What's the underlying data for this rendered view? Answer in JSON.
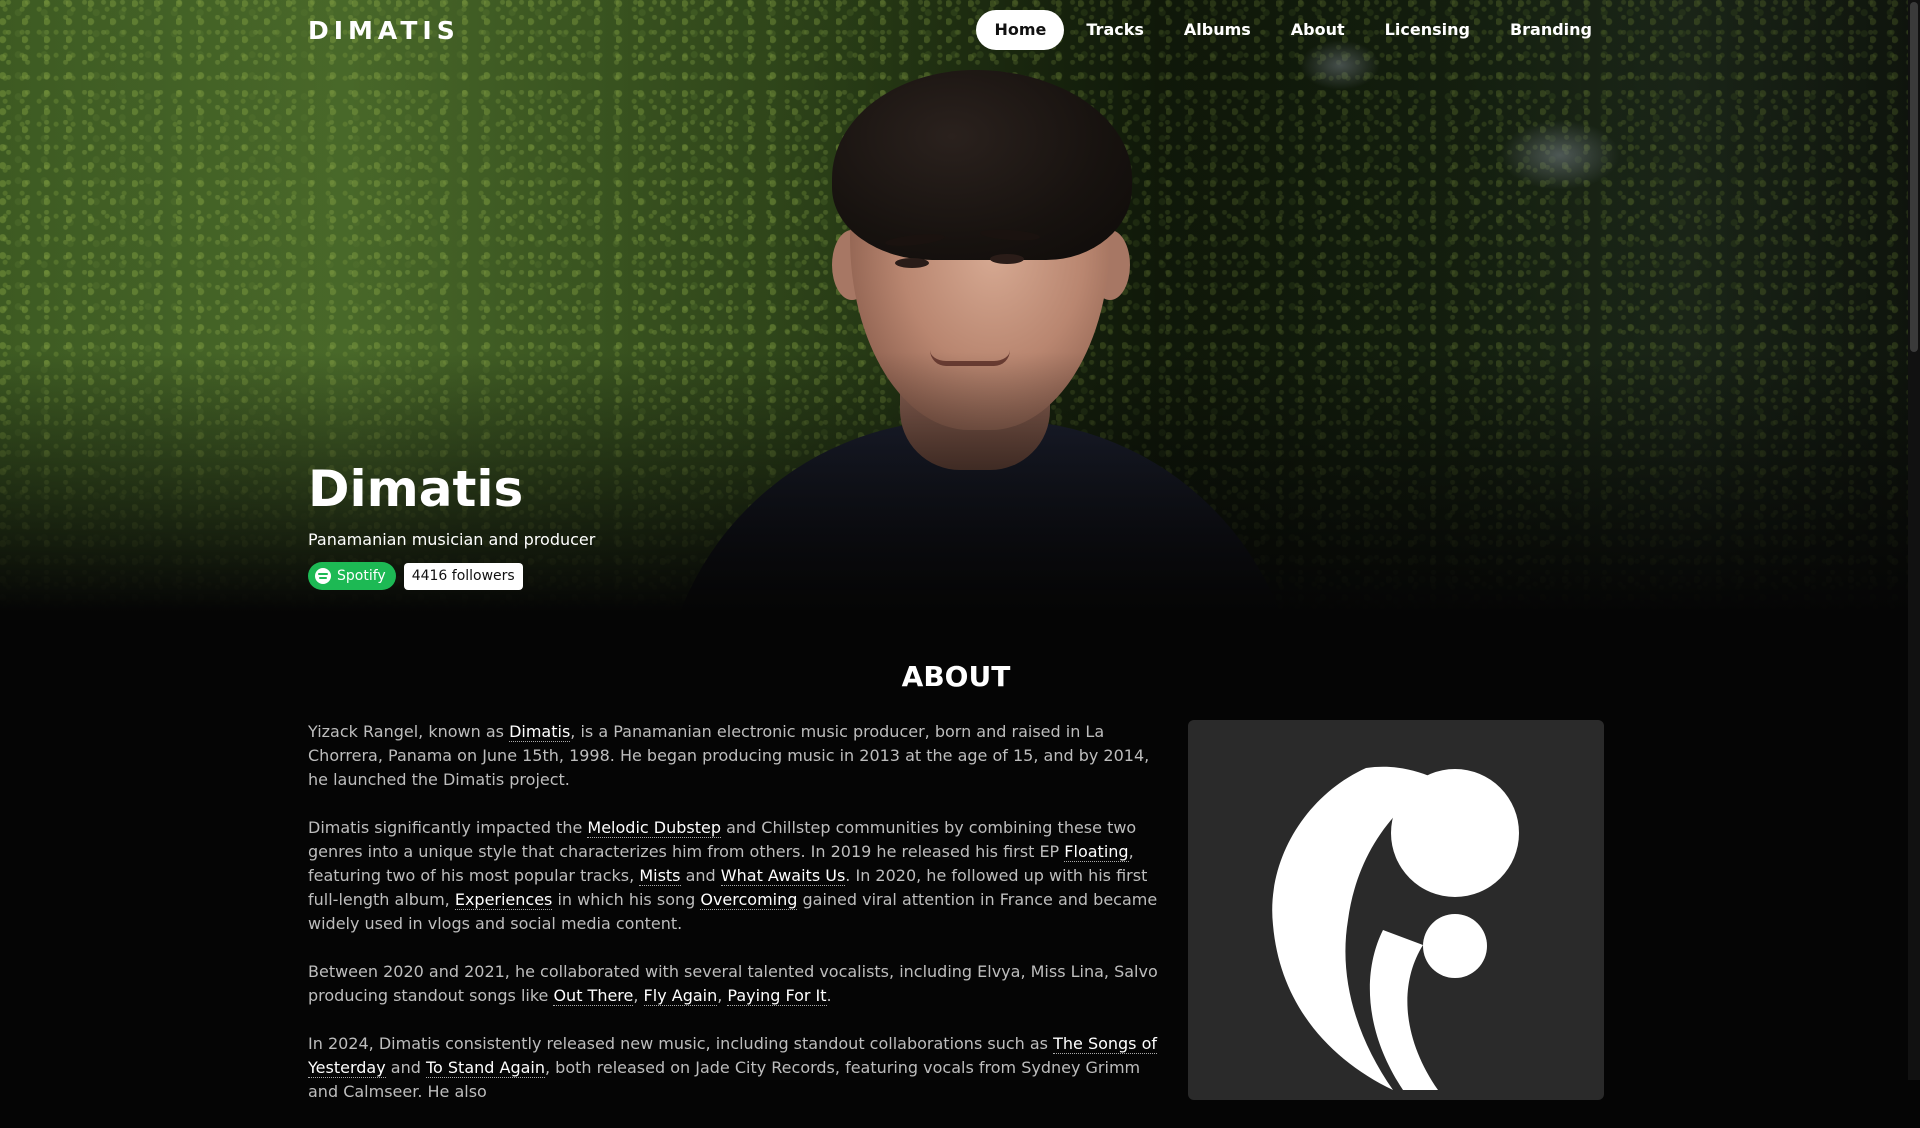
{
  "nav": {
    "logo": "DIMATIS",
    "items": [
      {
        "label": "Home",
        "active": true
      },
      {
        "label": "Tracks",
        "active": false
      },
      {
        "label": "Albums",
        "active": false
      },
      {
        "label": "About",
        "active": false
      },
      {
        "label": "Licensing",
        "active": false
      },
      {
        "label": "Branding",
        "active": false
      }
    ]
  },
  "hero": {
    "title": "Dimatis",
    "subtitle": "Panamanian musician and producer",
    "spotify_label": "Spotify",
    "followers": "4416 followers"
  },
  "about": {
    "heading": "ABOUT",
    "p1": {
      "t1": "Yizack Rangel, known as ",
      "l1": "Dimatis",
      "t2": ", is a Panamanian electronic music producer, born and raised in La Chorrera, Panama on June 15th, 1998. He began producing music in 2013 at the age of 15, and by 2014, he launched the Dimatis project."
    },
    "p2": {
      "t1": "Dimatis significantly impacted the ",
      "l1": "Melodic Dubstep",
      "t2": " and Chillstep communities by combining these two genres into a unique style that characterizes him from others. In 2019 he released his first EP ",
      "l2": "Floating",
      "t3": ", featuring two of his most popular tracks, ",
      "l3": "Mists",
      "t4": " and ",
      "l4": "What Awaits Us",
      "t5": ". In 2020, he followed up with his first full-length album, ",
      "l5": "Experiences",
      "t6": " in which his song ",
      "l6": "Overcoming",
      "t7": " gained viral attention in France and became widely used in vlogs and social media content."
    },
    "p3": {
      "t1": "Between 2020 and 2021, he collaborated with several talented vocalists, including Elvya, Miss Lina, Salvo producing standout songs like ",
      "l1": "Out There",
      "t2": ", ",
      "l2": "Fly Again",
      "t3": ", ",
      "l3": "Paying For It",
      "t4": "."
    },
    "p4": {
      "t1": "In 2024, Dimatis consistently released new music, including standout collaborations such as ",
      "l1": "The Songs of Yesterday",
      "t2": " and ",
      "l2": "To Stand Again",
      "t3": ", both released on Jade City Records, featuring vocals from Sydney Grimm and Calmseer. He also"
    }
  },
  "colors": {
    "background": "#050505",
    "spotify": "#1db954",
    "card": "#2a2a2a"
  },
  "icons": [
    "logo-mark-icon",
    "spotify-icon",
    "dimatis-emblem-icon"
  ]
}
